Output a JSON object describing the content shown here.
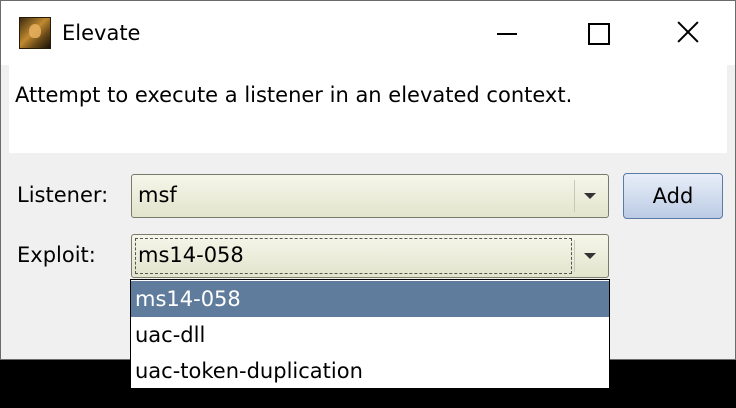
{
  "window": {
    "title": "Elevate",
    "icon": "app-icon"
  },
  "description": "Attempt to execute a listener in an elevated context.",
  "form": {
    "listener_label": "Listener:",
    "listener_value": "msf",
    "add_label": "Add",
    "exploit_label": "Exploit:",
    "exploit_value": "ms14-058"
  },
  "exploit_options": [
    "ms14-058",
    "uac-dll",
    "uac-token-duplication"
  ],
  "colors": {
    "selected_option": "#607c9c",
    "combo_background": "#e2e4cc",
    "button_background": "#bccbe4"
  }
}
